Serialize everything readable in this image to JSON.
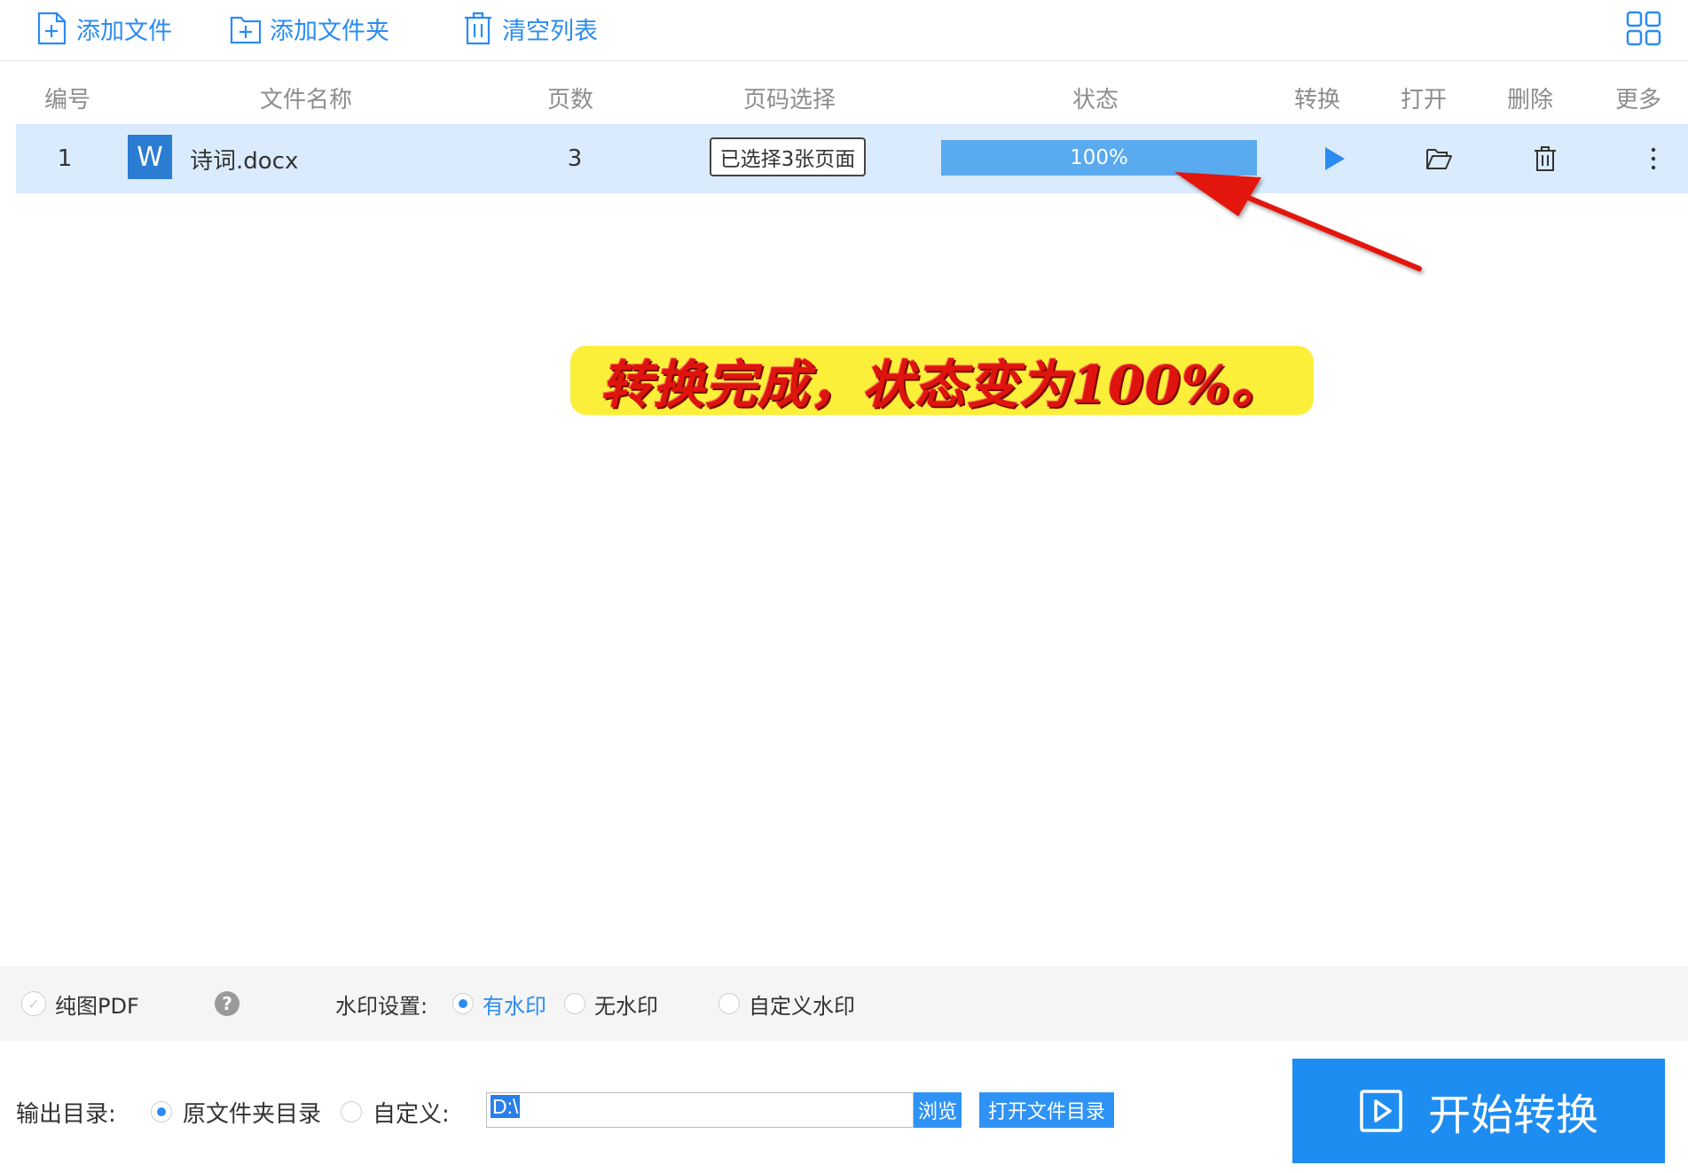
{
  "toolbar": {
    "add_file": "添加文件",
    "add_folder": "添加文件夹",
    "clear_list": "清空列表"
  },
  "table": {
    "headers": [
      "编号",
      "文件名称",
      "页数",
      "页码选择",
      "状态",
      "转换",
      "打开",
      "删除",
      "更多"
    ],
    "rows": [
      {
        "index": "1",
        "file_type_letter": "W",
        "file_name": "诗词.docx",
        "pages": "3",
        "page_selection": "已选择3张页面",
        "status_text": "100%",
        "progress": 1.0
      }
    ]
  },
  "annotation": {
    "text": "转换完成，状态变为100%。"
  },
  "options": {
    "pure_image_pdf": "纯图PDF",
    "help_symbol": "?",
    "watermark_label": "水印设置:",
    "with_watermark": "有水印",
    "no_watermark": "无水印",
    "custom_watermark": "自定义水印",
    "watermark_selected": "with_watermark"
  },
  "output": {
    "label": "输出目录:",
    "original_folder": "原文件夹目录",
    "custom": "自定义:",
    "path_value": "D:\\",
    "browse": "浏览",
    "open_folder": "打开文件目录",
    "selected": "original_folder"
  },
  "start_button": {
    "label": "开始转换"
  },
  "colors": {
    "accent": "#2a8cf0",
    "row_highlight": "#d9ebfc",
    "progress_fill": "#5aaaf0",
    "annotation_bg": "#fbef3a",
    "annotation_text": "#e0140e",
    "arrow": "#e3120b"
  },
  "icons": {
    "add_file": "file-plus-icon",
    "add_folder": "folder-plus-icon",
    "clear_list": "trash-icon",
    "grid": "grid-icon",
    "convert": "play-icon",
    "open": "folder-open-icon",
    "delete": "trash-icon",
    "more": "more-vertical-icon",
    "start": "play-square-icon"
  }
}
